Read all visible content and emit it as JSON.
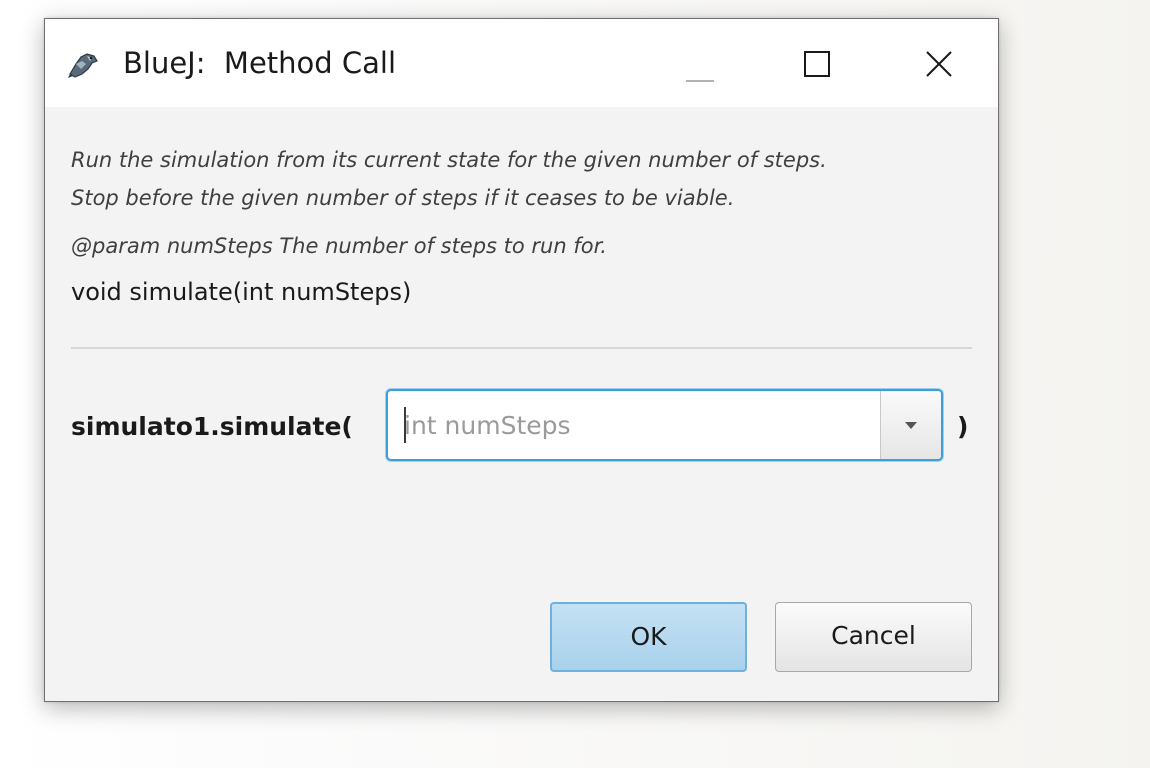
{
  "window": {
    "title": "BlueJ:  Method Call",
    "app_icon": "bluej-bird-icon",
    "controls": {
      "minimize_icon": "minimize-icon",
      "maximize_icon": "maximize-icon",
      "close_icon": "close-icon"
    }
  },
  "doc": {
    "line1": "Run the simulation from its current state for the given number of steps.",
    "line2": "Stop before the given number of steps if it ceases to be viable.",
    "param": "@param numSteps The number of steps to run for.",
    "signature": "void simulate(int numSteps)"
  },
  "call": {
    "prefix": "simulato1.simulate(",
    "suffix": ")",
    "argument": {
      "value": "",
      "placeholder": "int numSteps",
      "dropdown_icon": "chevron-down-icon"
    }
  },
  "buttons": {
    "ok": "OK",
    "cancel": "Cancel"
  },
  "colors": {
    "focus_border": "#3e9ed8",
    "ok_button_fill": "#b8daf0",
    "dialog_background": "#f3f3f3"
  }
}
